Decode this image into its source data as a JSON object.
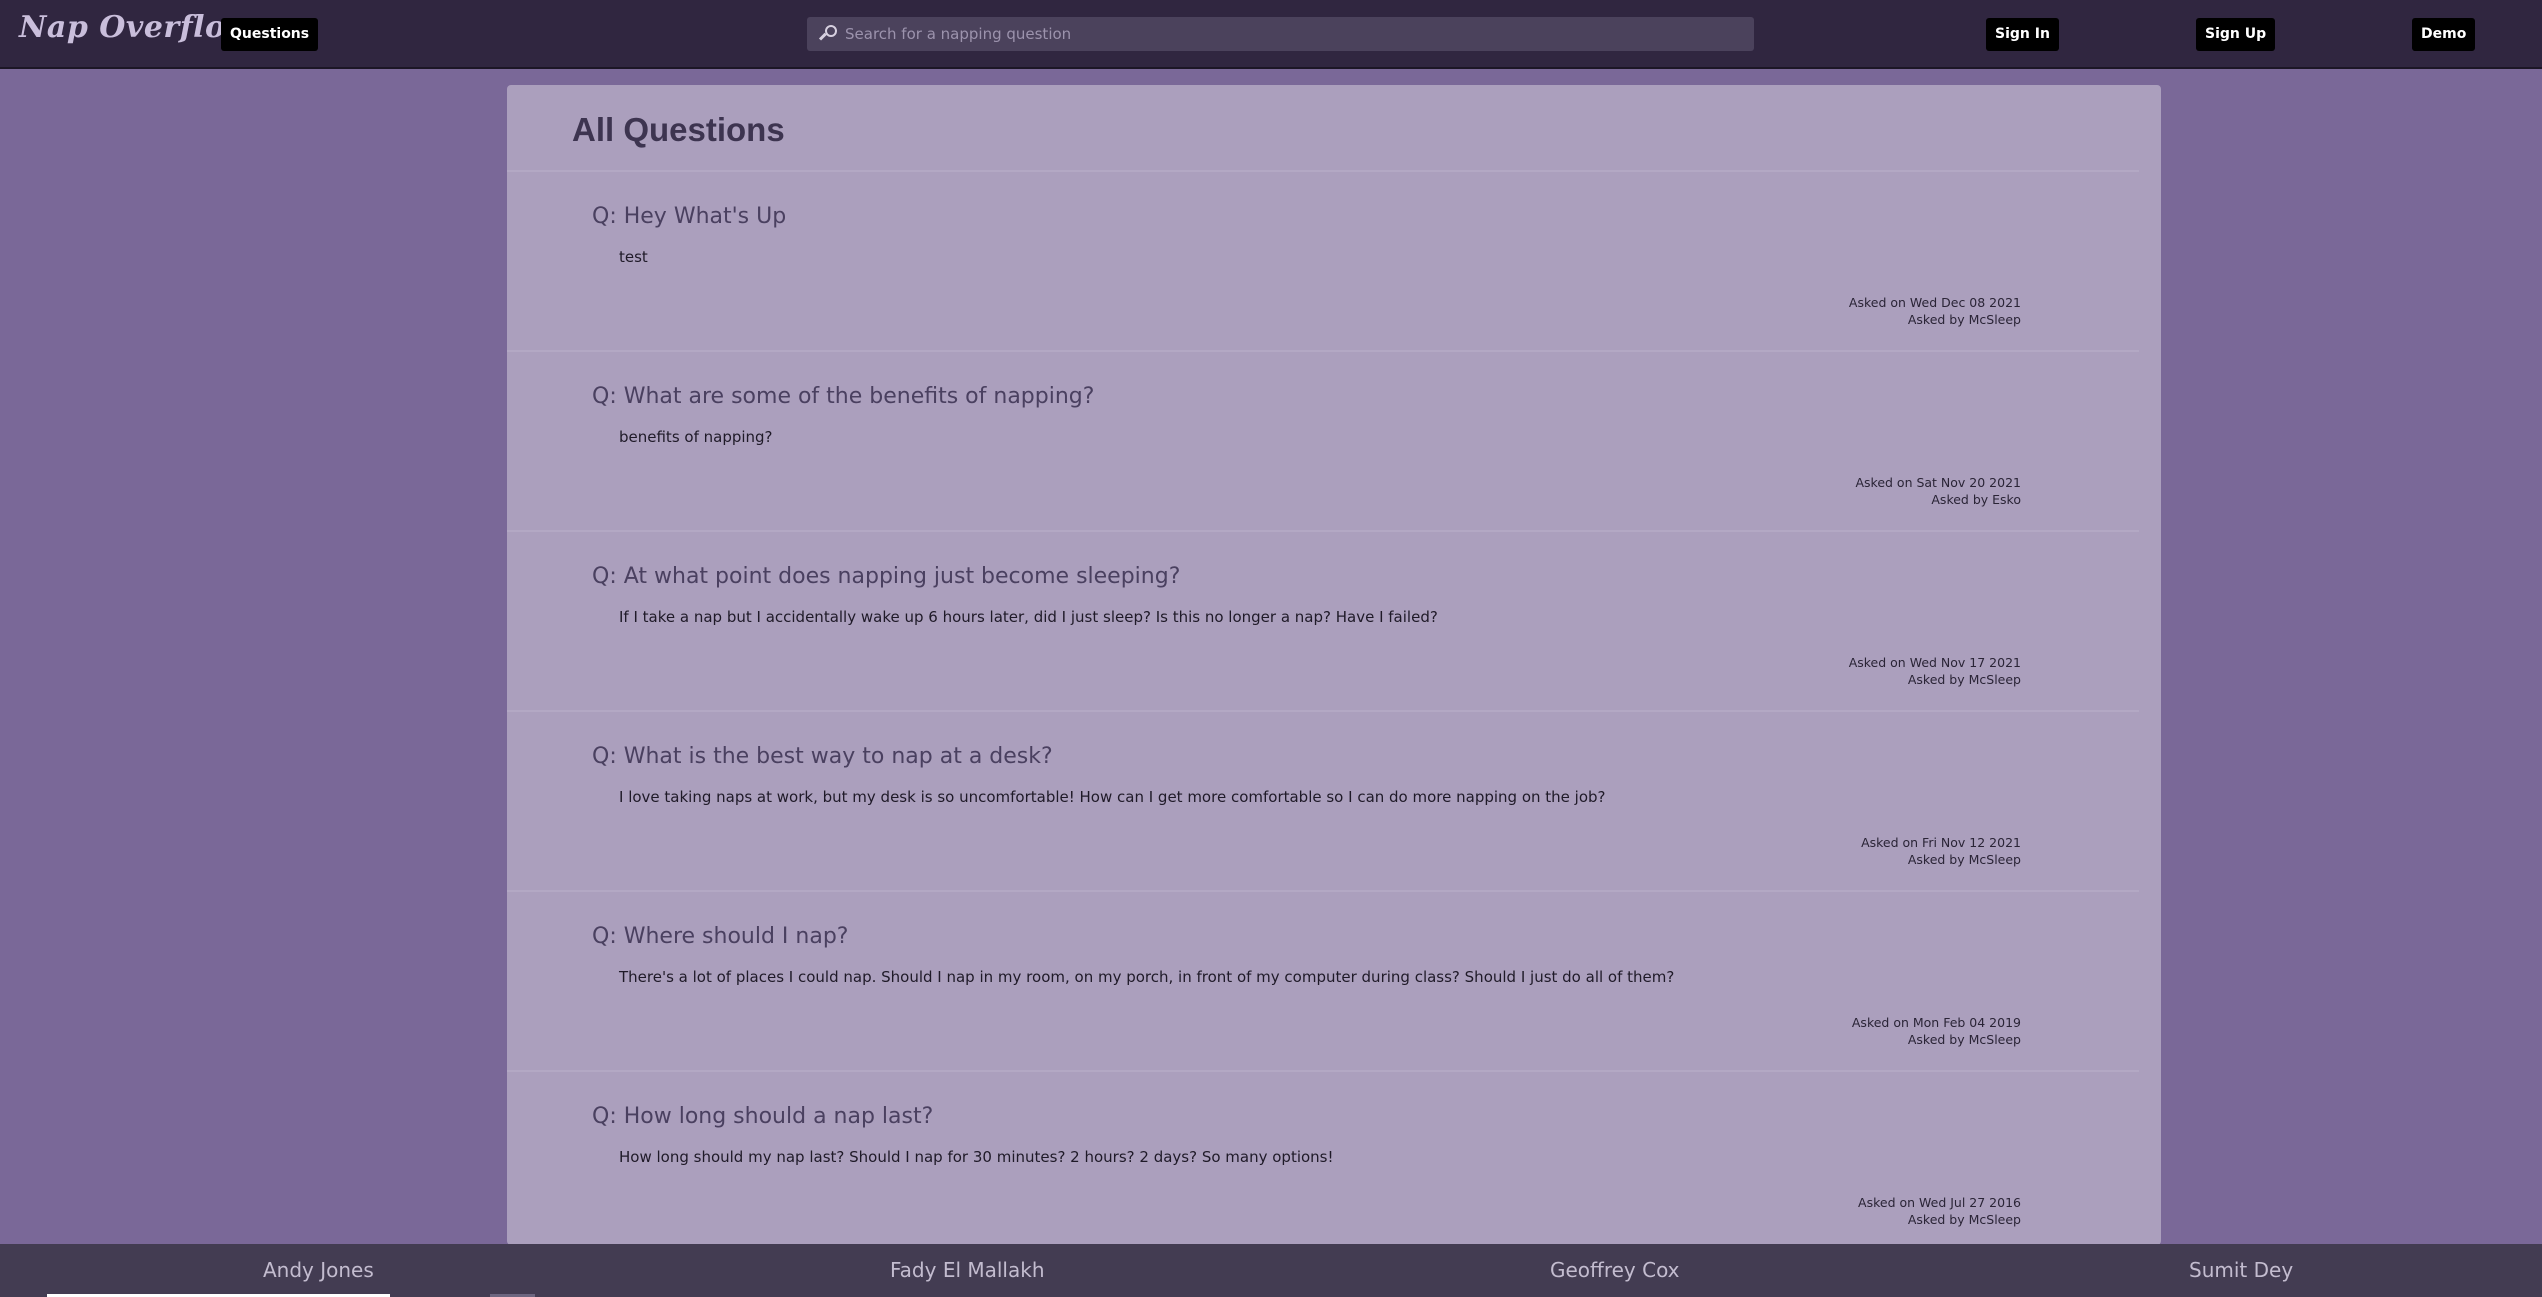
{
  "header": {
    "logo": "Nap Overflow",
    "questions_label": "Questions",
    "search_placeholder": "Search for a napping question",
    "sign_in_label": "Sign In",
    "sign_up_label": "Sign Up",
    "demo_label": "Demo"
  },
  "main": {
    "title": "All Questions",
    "questions": [
      {
        "title": "Q: Hey What's Up",
        "body": "test",
        "asked_on": "Asked on Wed Dec 08 2021",
        "asked_by": "Asked by McSleep"
      },
      {
        "title": "Q: What are some of the benefits of napping?",
        "body": "benefits of napping?",
        "asked_on": "Asked on Sat Nov 20 2021",
        "asked_by": "Asked by Esko"
      },
      {
        "title": "Q: At what point does napping just become sleeping?",
        "body": "If I take a nap but I accidentally wake up 6 hours later, did I just sleep? Is this no longer a nap? Have I failed?",
        "asked_on": "Asked on Wed Nov 17 2021",
        "asked_by": "Asked by McSleep"
      },
      {
        "title": "Q: What is the best way to nap at a desk?",
        "body": "I love taking naps at work, but my desk is so uncomfortable! How can I get more comfortable so I can do more napping on the job?",
        "asked_on": "Asked on Fri Nov 12 2021",
        "asked_by": "Asked by McSleep"
      },
      {
        "title": "Q: Where should I nap?",
        "body": "There's a lot of places I could nap. Should I nap in my room, on my porch, in front of my computer during class? Should I just do all of them?",
        "asked_on": "Asked on Mon Feb 04 2019",
        "asked_by": "Asked by McSleep"
      },
      {
        "title": "Q: How long should a nap last?",
        "body": "How long should my nap last? Should I nap for 30 minutes? 2 hours? 2 days? So many options!",
        "asked_on": "Asked on Wed Jul 27 2016",
        "asked_by": "Asked by McSleep"
      }
    ]
  },
  "footer": {
    "names": [
      "Andy Jones",
      "Fady El Mallakh",
      "Geoffrey Cox",
      "Sumit Dey"
    ]
  },
  "colors": {
    "page_background": "#7a6898",
    "header_background": "#302640",
    "panel_background": "#ab9fbd",
    "footer_background": "#433c52"
  },
  "icons": {
    "search": "search-icon"
  }
}
